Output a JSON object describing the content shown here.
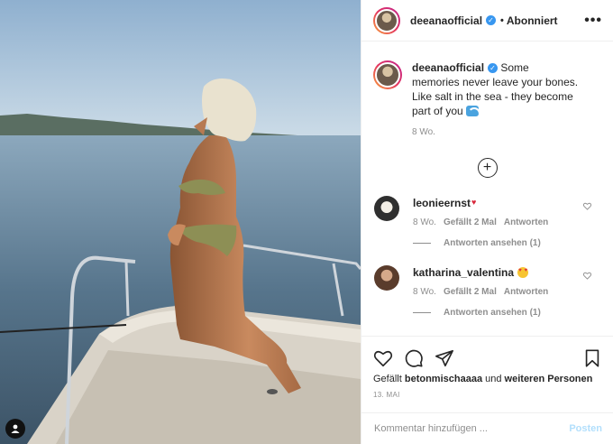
{
  "post": {
    "username": "deeanaofficial",
    "follow_state": "Abonniert",
    "caption": "Some memories never leave your bones. Like salt in the sea - they become part of you",
    "caption_emoji": "wave-emoji",
    "time_ago": "8 Wo.",
    "date": "13. MAI"
  },
  "comments": [
    {
      "username": "leonieernst",
      "emoji": "heart-emoji",
      "time": "8 Wo.",
      "likes": "Gefällt 2 Mal",
      "reply": "Antworten",
      "view_replies": "Antworten ansehen (1)"
    },
    {
      "username": "katharina_valentina",
      "emoji": "heart-eyes-emoji",
      "time": "8 Wo.",
      "likes": "Gefällt 2 Mal",
      "reply": "Antworten",
      "view_replies": "Antworten ansehen (1)"
    }
  ],
  "likes_line": {
    "prefix": "Gefällt",
    "user": "betonmischaaaa",
    "conjunction": "und",
    "others": "weiteren Personen"
  },
  "comment_box": {
    "placeholder": "Kommentar hinzufügen ...",
    "post_label": "Posten"
  },
  "icons": [
    "verified-badge-icon",
    "more-options-icon",
    "load-more-icon",
    "like-icon",
    "comment-icon",
    "share-icon",
    "bookmark-icon",
    "comment-like-icon"
  ],
  "colors": {
    "verified": "#3897f0",
    "post_button": "#b2dffc",
    "muted": "#8e8e8e"
  }
}
